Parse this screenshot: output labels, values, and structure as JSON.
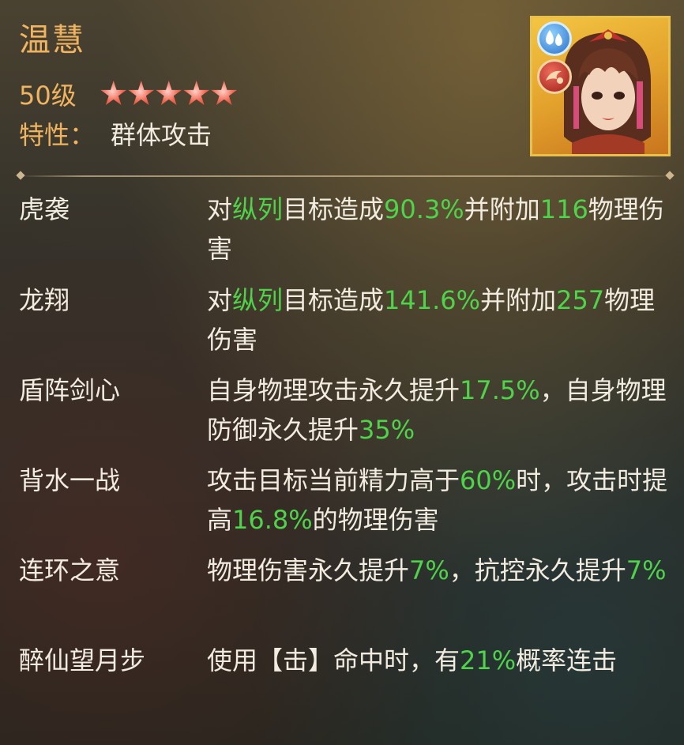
{
  "hero": {
    "name": "温慧",
    "level": "50级",
    "stars": 5,
    "trait_label": "特性：",
    "trait_value": "群体攻击",
    "element_icon": "water-drops-icon",
    "attack_icon": "attack-emblem-icon"
  },
  "skills": [
    {
      "name": "虎袭",
      "desc": [
        {
          "t": "对"
        },
        {
          "t": "纵列",
          "hl": true
        },
        {
          "t": "目标造成"
        },
        {
          "t": "90.3%",
          "hl": true
        },
        {
          "t": "并附加"
        },
        {
          "t": "116",
          "hl": true
        },
        {
          "t": "物理伤害"
        }
      ]
    },
    {
      "name": "龙翔",
      "desc": [
        {
          "t": "对"
        },
        {
          "t": "纵列",
          "hl": true
        },
        {
          "t": "目标造成"
        },
        {
          "t": "141.6%",
          "hl": true
        },
        {
          "t": "并附加"
        },
        {
          "t": "257",
          "hl": true
        },
        {
          "t": "物理伤害"
        }
      ]
    },
    {
      "name": "盾阵剑心",
      "desc": [
        {
          "t": "自身物理攻击永久提升"
        },
        {
          "t": "17.5%",
          "hl": true
        },
        {
          "t": "，自身物理防御永久提升"
        },
        {
          "t": "35%",
          "hl": true
        }
      ]
    },
    {
      "name": "背水一战",
      "desc": [
        {
          "t": "攻击目标当前精力高于"
        },
        {
          "t": "60%",
          "hl": true
        },
        {
          "t": "时，攻击时提高"
        },
        {
          "t": "16.8%",
          "hl": true
        },
        {
          "t": "的物理伤害"
        }
      ]
    },
    {
      "name": "连环之意",
      "desc": [
        {
          "t": "物理伤害永久提升"
        },
        {
          "t": "7%",
          "hl": true
        },
        {
          "t": "，抗控永久提升"
        },
        {
          "t": "7%",
          "hl": true
        }
      ]
    },
    {
      "name": "醉仙望月步",
      "desc": [
        {
          "t": "使用【击】命中时，有"
        },
        {
          "t": "21%",
          "hl": true
        },
        {
          "t": "概率连击"
        }
      ]
    }
  ],
  "colors": {
    "accent_gold": "#f0b461",
    "highlight_green": "#4fd34a",
    "text": "#f2ece0"
  }
}
